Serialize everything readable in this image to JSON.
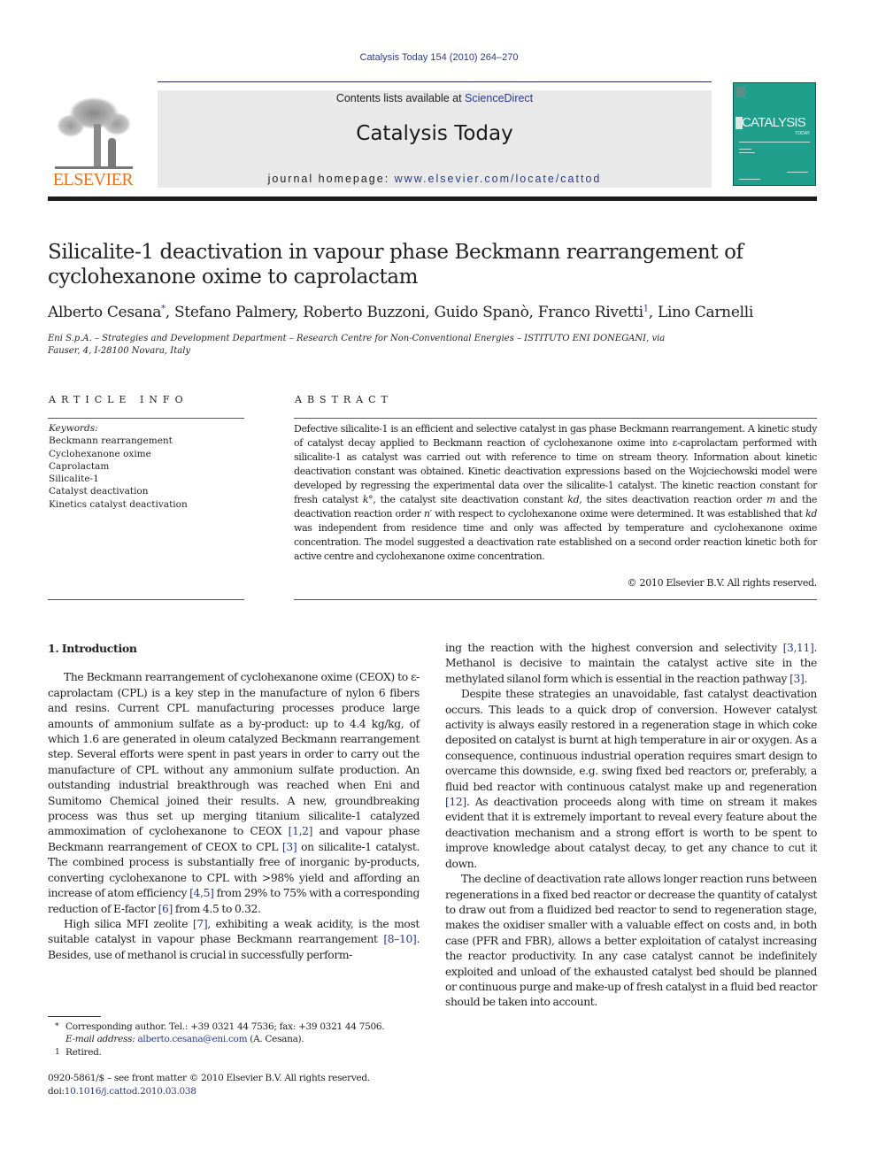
{
  "running_head": "Catalysis Today 154 (2010) 264–270",
  "masthead": {
    "publisher_logo_text": "ELSEVIER",
    "contents_prefix": "Contents lists available at ",
    "contents_link": "ScienceDirect",
    "journal_title": "Catalysis Today",
    "homepage_prefix": "journal homepage: ",
    "homepage_link": "www.elsevier.com/locate/cattod",
    "cover": {
      "title": "CATALYSIS",
      "subtitle": "TODAY",
      "color": "#1f9e8c"
    },
    "logo_color": "#e8731f",
    "link_color": "#2b3a8f"
  },
  "article": {
    "title": "Silicalite-1 deactivation in vapour phase Beckmann rearrangement of cyclohexanone oxime to caprolactam",
    "authors": [
      {
        "name": "Alberto Cesana",
        "mark": "*",
        "sep": ", "
      },
      {
        "name": "Stefano Palmery",
        "mark": "",
        "sep": ", "
      },
      {
        "name": "Roberto Buzzoni",
        "mark": "",
        "sep": ", "
      },
      {
        "name": "Guido Spanò",
        "mark": "",
        "sep": ", "
      },
      {
        "name": "Franco Rivetti",
        "mark": "1",
        "sep": ", "
      },
      {
        "name": "Lino Carnelli",
        "mark": "",
        "sep": ""
      }
    ],
    "affiliation": "Eni S.p.A. – Strategies and Development Department – Research Centre for Non-Conventional Energies – ISTITUTO ENI DONEGANI, via Fauser, 4, I-28100 Novara, Italy"
  },
  "article_info": {
    "heading": "ARTICLE INFO",
    "keywords_label": "Keywords:",
    "keywords": [
      "Beckmann rearrangement",
      "Cyclohexanone oxime",
      "Caprolactam",
      "Silicalite-1",
      "Catalyst deactivation",
      "Kinetics catalyst deactivation"
    ]
  },
  "abstract": {
    "heading": "ABSTRACT",
    "p1": "Defective silicalite-1 is an efficient and selective catalyst in gas phase Beckmann rearrangement. A kinetic study of catalyst decay applied to Beckmann reaction of cyclohexanone oxime into ε-caprolactam performed with silicalite-1 as catalyst was carried out with reference to time on stream theory. Information about kinetic deactivation constant was obtained. Kinetic deactivation expressions based on the Wojciechowski model were developed by regressing the experimental data over the silicalite-1 catalyst. The kinetic reaction constant for fresh catalyst ",
    "k0": "k°",
    "p2": ", the catalyst site deactivation constant ",
    "kd": "kd",
    "p3": ", the sites deactivation reaction order ",
    "m": "m",
    "p4": " and the deactivation reaction order ",
    "n": "n′",
    "p5": " with respect to cyclohexanone oxime were determined. It was established that ",
    "kd2": "kd",
    "p6": " was independent from residence time and only was affected by temperature and cyclohexanone oxime concentration. The model suggested a deactivation rate established on a second order reaction kinetic both for active centre and cyclohexanone oxime concentration.",
    "copyright": "© 2010 Elsevier B.V. All rights reserved."
  },
  "body": {
    "section_heading": "1.  Introduction",
    "left": {
      "p1a": "The Beckmann rearrangement of cyclohexanone oxime (CEOX) to ε-caprolactam (CPL) is a key step in the manufacture of nylon 6 fibers and resins. Current CPL manufacturing processes produce large amounts of ammonium sulfate as a by-product: up to 4.4 kg/kg, of which 1.6 are generated in oleum catalyzed Beckmann rearrangement step. Several efforts were spent in past years in order to carry out the manufacture of CPL without any ammonium sulfate production. An outstanding industrial breakthrough was reached when Eni and Sumitomo Chemical joined their results. A new, groundbreaking process was thus set up merging titanium silicalite-1 catalyzed ammoximation of cyclohexanone to CEOX ",
      "ref1": "[1,2]",
      "p1b": " and vapour phase Beckmann rearrangement of CEOX to CPL ",
      "ref2": "[3]",
      "p1c": " on silicalite-1 catalyst. The combined process is substantially free of inorganic by-products, converting cyclohexanone to CPL with >98% yield and affording an increase of atom efficiency ",
      "ref3": "[4,5]",
      "p1d": " from 29% to 75% with a corresponding reduction of E-factor ",
      "ref4": "[6]",
      "p1e": " from 4.5 to 0.32.",
      "p2a": "High silica MFI zeolite ",
      "ref5": "[7]",
      "p2b": ", exhibiting a weak acidity, is the most suitable catalyst in vapour phase Beckmann rearrangement ",
      "ref6": "[8–10]",
      "p2c": ". Besides, use of methanol is crucial in successfully perform-"
    },
    "right": {
      "p1a": "ing the reaction with the highest conversion and selectivity ",
      "ref1": "[3,11]",
      "p1b": ". Methanol is decisive to maintain the catalyst active site in the methylated silanol form which is essential in the reaction pathway ",
      "ref2": "[3]",
      "p1c": ".",
      "p2a": "Despite these strategies an unavoidable, fast catalyst deactivation occurs. This leads to a quick drop of conversion. However catalyst activity is always easily restored in a regeneration stage in which coke deposited on catalyst is burnt at high temperature in air or oxygen. As a consequence, continuous industrial operation requires smart design to overcame this downside, e.g. swing fixed bed reactors or, preferably, a fluid bed reactor with continuous catalyst make up and regeneration ",
      "ref3": "[12]",
      "p2b": ". As deactivation proceeds along with time on stream it makes evident that it is extremely important to reveal every feature about the deactivation mechanism and a strong effort is worth to be spent to improve knowledge about catalyst decay, to get any chance to cut it down.",
      "p3": "The decline of deactivation rate allows longer reaction runs between regenerations in a fixed bed reactor or decrease the quantity of catalyst to draw out from a fluidized bed reactor to send to regeneration stage, makes the oxidiser smaller with a valuable effect on costs and, in both case (PFR and FBR), allows a better exploitation of catalyst increasing the reactor productivity. In any case catalyst cannot be indefinitely exploited and unload of the exhausted catalyst bed should be planned or continuous purge and make-up of fresh catalyst in a fluid bed reactor should be taken into account."
    }
  },
  "footnotes": {
    "corr_mark": "*",
    "corr_text": "Corresponding author. Tel.: +39 0321 44 7536; fax: +39 0321 44 7506.",
    "email_label": "E-mail address: ",
    "email": "alberto.cesana@eni.com",
    "email_suffix": " (A. Cesana).",
    "retired_mark": "1",
    "retired_text": "Retired."
  },
  "front_matter": {
    "issn_line": "0920-5861/$ – see front matter © 2010 Elsevier B.V. All rights reserved.",
    "doi_prefix": "doi:",
    "doi": "10.1016/j.cattod.2010.03.038"
  }
}
